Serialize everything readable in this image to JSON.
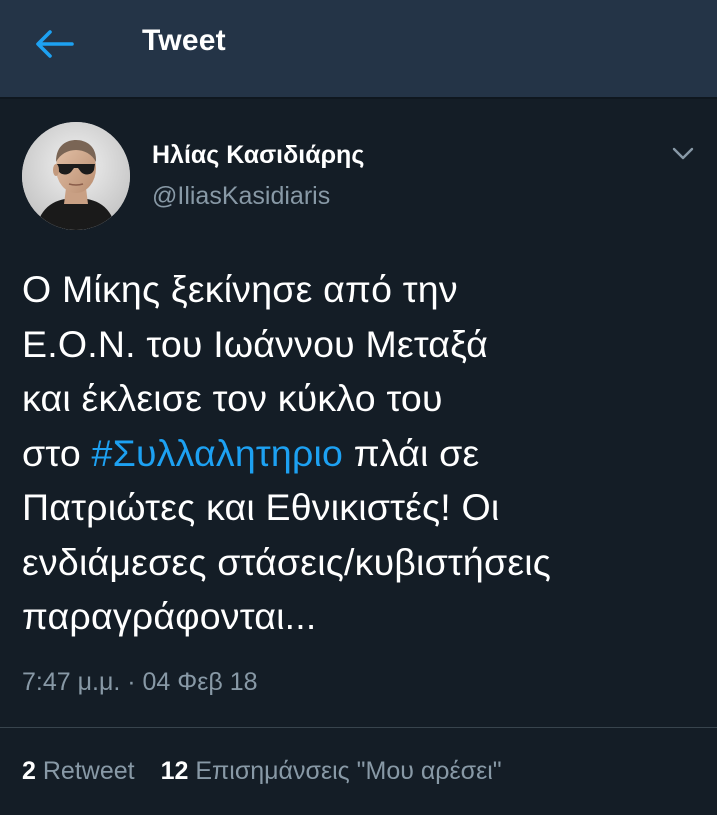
{
  "header": {
    "title": "Tweet",
    "back_icon": "arrow-left-icon",
    "accent": "#1da1f2"
  },
  "tweet": {
    "author": {
      "display_name": "Ηλίας Κασιδιάρης",
      "handle": "@IliasKasidiaris"
    },
    "menu_icon": "chevron-down-icon",
    "text_lines": [
      "Ο Μίκης ξεκίνησε από την",
      "Ε.Ο.Ν. του Ιωάννου Μεταξά",
      "και έκλεισε τον κύκλο του"
    ],
    "line4_prefix": "στο ",
    "hashtag": "#Συλλαλητηριο",
    "line4_suffix": " πλάι σε",
    "text_lines_after": [
      "Πατριώτες και Εθνικιστές! Οι",
      "ενδιάμεσες στάσεις/κυβιστήσεις",
      "παραγράφονται..."
    ],
    "timestamp": "7:47 μ.μ. · 04 Φεβ 18",
    "stats": {
      "retweet_count": "2",
      "retweet_label": "Retweet",
      "likes_count": "12",
      "likes_label": "Επισημάνσεις \"Μου αρέσει\""
    }
  },
  "colors": {
    "background": "#141d26",
    "header_bg": "#243447",
    "secondary_text": "#8899a6",
    "hashtag": "#1da1f2"
  }
}
